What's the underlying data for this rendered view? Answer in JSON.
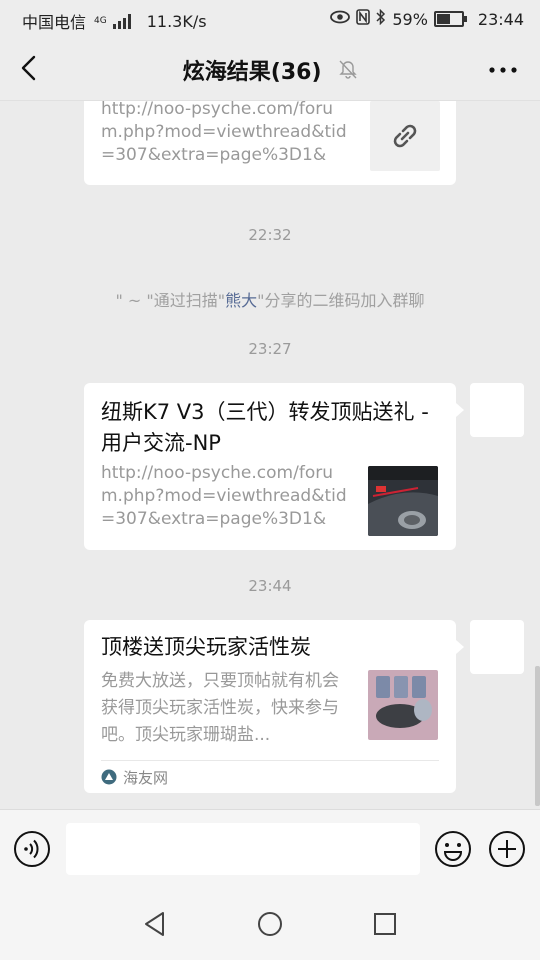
{
  "status_bar": {
    "carrier": "中国电信",
    "network_type": "4G",
    "speed": "11.3K/s",
    "battery": "59%",
    "battery_level": 0.59,
    "time": "23:44"
  },
  "header": {
    "title": "炫海结果(36)",
    "back_icon": "chevron-left-icon",
    "mute_icon": "bell-off-icon",
    "more_icon": "more-dots-icon"
  },
  "messages": {
    "link_card_top": {
      "url": "http://noo-psyche.com/forum.php?mod=viewthread&tid=307&extra=page%3D1&m...",
      "icon": "link-icon"
    },
    "ts_1": "22:32",
    "system_notice": {
      "prefix": "\" ~ \"通过扫描\"",
      "highlight": "熊大",
      "suffix": "\"分享的二维码加入群聊"
    },
    "ts_2": "23:27",
    "link_card_2": {
      "title": "纽斯K7 V3（三代）转发顶贴送礼 - 用户交流-NP",
      "url": "http://noo-psyche.com/forum.php?mod=viewthread&tid=307&extra=page%3D1&m..."
    },
    "ts_3": "23:44",
    "link_card_3": {
      "title": "顶楼送顶尖玩家活性炭",
      "description": "免费大放送，只要顶帖就有机会获得顶尖玩家活性炭，快来参与吧。顶尖玩家珊瑚盐...",
      "source": "海友网"
    }
  },
  "input_bar": {
    "voice_icon": "voice-icon",
    "emoji_icon": "emoji-icon",
    "plus_icon": "plus-circle-icon",
    "text_value": ""
  },
  "nav_bar": {
    "back": "triangle-back-icon",
    "home": "circle-home-icon",
    "recents": "square-recents-icon"
  },
  "colors": {
    "background": "#ebebeb",
    "card": "#ffffff",
    "highlight_name": "#576b95",
    "muted_text": "#999999"
  }
}
